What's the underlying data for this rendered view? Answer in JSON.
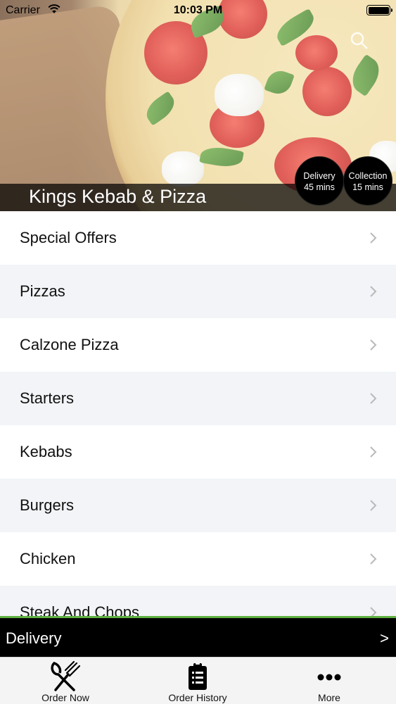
{
  "status_bar": {
    "carrier": "Carrier",
    "time": "10:03 PM"
  },
  "header": {
    "restaurant_name": "Kings Kebab & Pizza",
    "delivery_badge": {
      "label": "Delivery",
      "time": "45 mins"
    },
    "collection_badge": {
      "label": "Collection",
      "time": "15 mins"
    },
    "search_icon": "search-icon"
  },
  "categories": [
    {
      "label": "Special Offers"
    },
    {
      "label": "Pizzas"
    },
    {
      "label": "Calzone Pizza"
    },
    {
      "label": "Starters"
    },
    {
      "label": "Kebabs"
    },
    {
      "label": "Burgers"
    },
    {
      "label": "Chicken"
    },
    {
      "label": "Steak And Chops"
    }
  ],
  "delivery_bar": {
    "label": "Delivery",
    "arrow": ">"
  },
  "tab_bar": {
    "tabs": [
      {
        "label": "Order Now",
        "icon": "fork-knife-icon"
      },
      {
        "label": "Order History",
        "icon": "clipboard-list-icon"
      },
      {
        "label": "More",
        "icon": "more-dots-icon"
      }
    ]
  },
  "colors": {
    "accent_green": "#5db042",
    "title_overlay": "#000000",
    "row_alt": "#f2f4f7"
  }
}
